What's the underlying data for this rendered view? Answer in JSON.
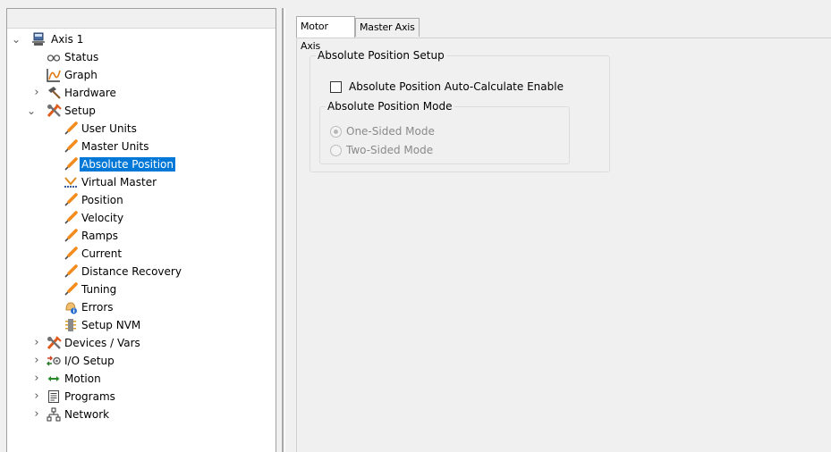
{
  "tree": {
    "rows": [
      {
        "label": "Axis 1",
        "icon": "drive-icon",
        "expander": "expanded"
      },
      {
        "label": "Status",
        "icon": "glasses-icon",
        "expander": "none"
      },
      {
        "label": "Graph",
        "icon": "graph-icon",
        "expander": "none"
      },
      {
        "label": "Hardware",
        "icon": "hammer-icon",
        "expander": "collapsed"
      },
      {
        "label": "Setup",
        "icon": "tools-icon",
        "expander": "expanded"
      },
      {
        "label": "User Units",
        "icon": "pin-icon",
        "expander": "none"
      },
      {
        "label": "Master Units",
        "icon": "pin-icon",
        "expander": "none"
      },
      {
        "label": "Absolute Position",
        "icon": "pin-icon",
        "expander": "none",
        "selected": true
      },
      {
        "label": "Virtual Master",
        "icon": "virtual-master-icon",
        "expander": "none"
      },
      {
        "label": "Position",
        "icon": "pin-icon",
        "expander": "none"
      },
      {
        "label": "Velocity",
        "icon": "pin-icon",
        "expander": "none"
      },
      {
        "label": "Ramps",
        "icon": "pin-icon",
        "expander": "none"
      },
      {
        "label": "Current",
        "icon": "pin-icon",
        "expander": "none"
      },
      {
        "label": "Distance Recovery",
        "icon": "pin-icon",
        "expander": "none"
      },
      {
        "label": "Tuning",
        "icon": "pin-icon",
        "expander": "none"
      },
      {
        "label": "Errors",
        "icon": "errors-icon",
        "expander": "none"
      },
      {
        "label": "Setup NVM",
        "icon": "nvm-icon",
        "expander": "none"
      },
      {
        "label": "Devices / Vars",
        "icon": "tools-icon",
        "expander": "collapsed"
      },
      {
        "label": "I/O Setup",
        "icon": "io-icon",
        "expander": "collapsed"
      },
      {
        "label": "Motion",
        "icon": "motion-arrows-icon",
        "expander": "collapsed"
      },
      {
        "label": "Programs",
        "icon": "programs-icon",
        "expander": "collapsed"
      },
      {
        "label": "Network",
        "icon": "network-icon",
        "expander": "collapsed"
      }
    ]
  },
  "tabs": [
    {
      "label": "Motor Axis",
      "active": true
    },
    {
      "label": "Master Axis",
      "active": false
    }
  ],
  "setup_group": {
    "title": "Absolute Position Setup",
    "enable_checkbox": {
      "label": "Absolute Position Auto-Calculate Enable",
      "checked": false
    },
    "mode_group": {
      "title": "Absolute Position Mode",
      "options": [
        {
          "label": "One-Sided Mode",
          "checked": true,
          "enabled": false
        },
        {
          "label": "Two-Sided Mode",
          "checked": false,
          "enabled": false
        }
      ]
    }
  },
  "colors": {
    "selection": "#0078d7",
    "pin_orange": "#f28c1e",
    "panel_bg": "#f0f0f0"
  }
}
